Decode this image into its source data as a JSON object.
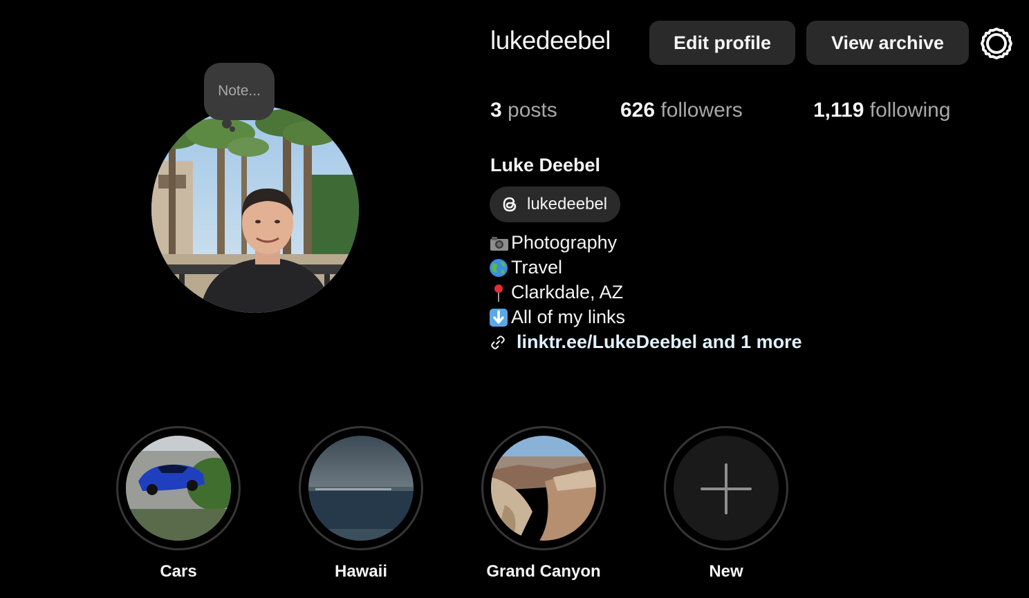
{
  "profile": {
    "username": "lukedeebel",
    "full_name": "Luke Deebel",
    "note_placeholder": "Note...",
    "avatar_icon": "profile-photo"
  },
  "header": {
    "edit_profile_label": "Edit profile",
    "view_archive_label": "View archive",
    "settings_icon": "gear-icon"
  },
  "stats": {
    "posts_count": "3",
    "posts_label": "posts",
    "followers_count": "626",
    "followers_label": "followers",
    "following_count": "1,119",
    "following_label": "following"
  },
  "threads": {
    "icon": "threads-icon",
    "handle": "lukedeebel"
  },
  "bio": {
    "lines": [
      {
        "icon": "camera-emoji",
        "text": "Photography"
      },
      {
        "icon": "globe-emoji",
        "text": "Travel"
      },
      {
        "icon": "pin-emoji",
        "text": "Clarkdale, AZ"
      },
      {
        "icon": "down-arrow-emoji",
        "text": "All of my links"
      }
    ],
    "link": {
      "icon": "link-icon",
      "text": "linktr.ee/LukeDeebel and 1 more"
    }
  },
  "highlights": [
    {
      "label": "Cars",
      "icon": "car-thumbnail"
    },
    {
      "label": "Hawaii",
      "icon": "ocean-thumbnail"
    },
    {
      "label": "Grand Canyon",
      "icon": "canyon-thumbnail"
    },
    {
      "label": "New",
      "icon": "plus-icon"
    }
  ],
  "colors": {
    "background": "#000000",
    "button": "#2a2a2a",
    "secondary_text": "#a8a8a8",
    "link": "#e0f1ff",
    "ring": "#363636"
  }
}
